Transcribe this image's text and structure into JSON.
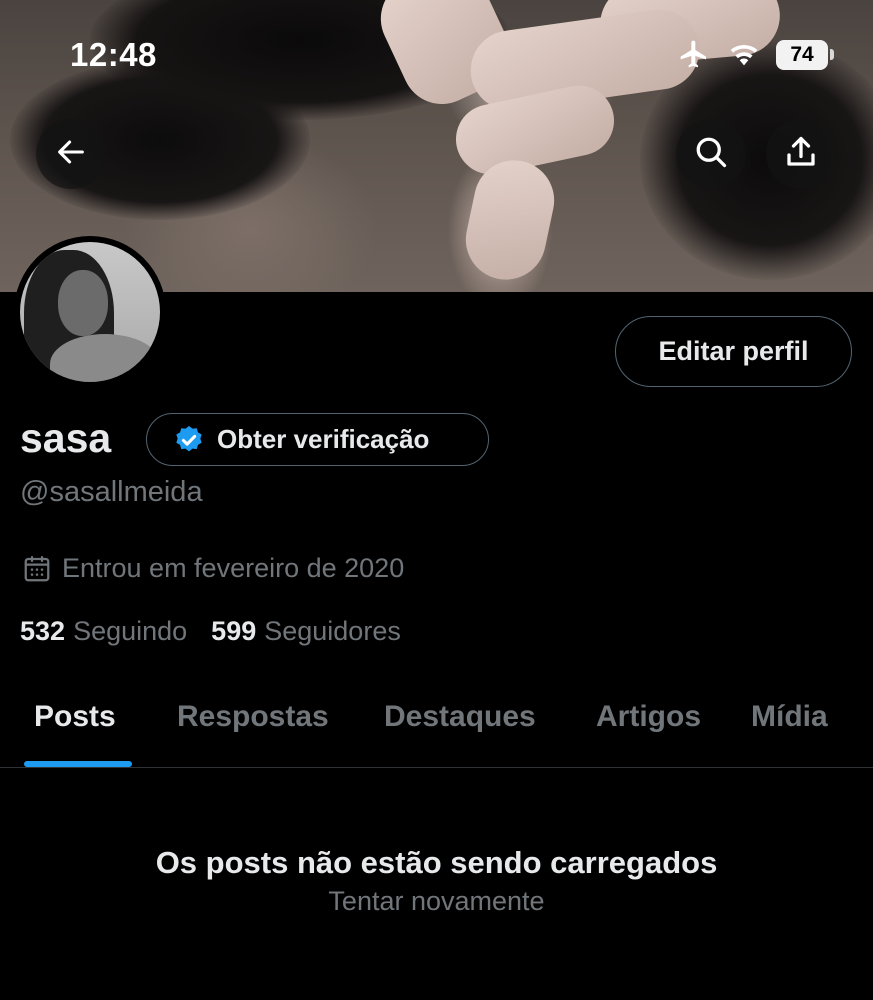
{
  "status_bar": {
    "time": "12:48",
    "battery": "74",
    "icons": [
      "airplane-icon",
      "wifi-icon",
      "battery-icon"
    ]
  },
  "header": {
    "icons": [
      "back-arrow-icon",
      "search-icon",
      "share-icon"
    ]
  },
  "profile": {
    "display_name": "sasa",
    "verify_label": "Obter verificação",
    "handle": "@sasallmeida",
    "joined": "Entrou em fevereiro de 2020",
    "edit_label": "Editar perfil",
    "following_count": "532",
    "following_label": "Seguindo",
    "followers_count": "599",
    "followers_label": "Seguidores"
  },
  "tabs": [
    {
      "label": "Posts",
      "active": true
    },
    {
      "label": "Respostas",
      "active": false
    },
    {
      "label": "Destaques",
      "active": false
    },
    {
      "label": "Artigos",
      "active": false
    },
    {
      "label": "Mídia",
      "active": false
    }
  ],
  "feed": {
    "error_title": "Os posts não estão sendo carregados",
    "retry_label": "Tentar novamente"
  },
  "colors": {
    "background": "#000000",
    "accent": "#1d9bf0",
    "text_primary": "#e7e9ea",
    "text_secondary": "#71767b",
    "border": "#536471"
  }
}
